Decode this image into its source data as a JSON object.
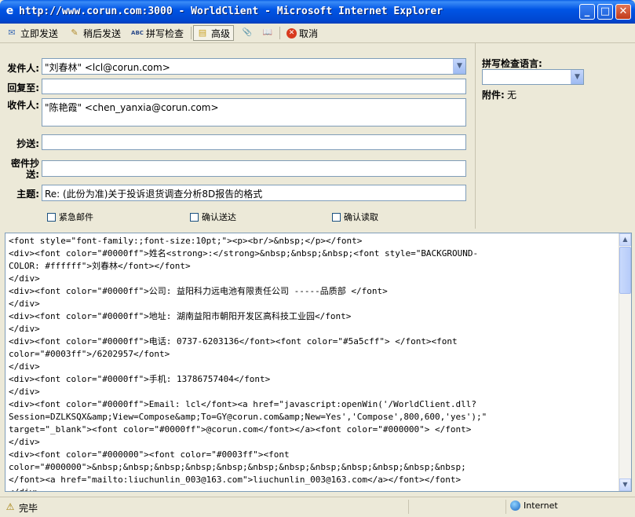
{
  "window": {
    "title": "http://www.corun.com:3000 - WorldClient - Microsoft Internet Explorer",
    "min_glyph": "_",
    "max_glyph": "□",
    "close_glyph": "✕"
  },
  "toolbar": {
    "send_now": "立即发送",
    "send_later": "稍后发送",
    "spell_check": "拼写检查",
    "advanced": "高级",
    "cancel": "取消"
  },
  "icons": {
    "send-now": "✉",
    "send-later": "✎",
    "spell-check": "ABC",
    "advanced": "▤",
    "attach": "📎",
    "address-book": "📖",
    "cancel": "✕",
    "ie": "e",
    "status-page": "⚠",
    "combo": "▼",
    "scroll-up": "▲",
    "scroll-down": "▼"
  },
  "fields": {
    "from_label": "发件人:",
    "from_value": "\"刘春林\" <lcl@corun.com>",
    "reply_to_label": "回复至:",
    "reply_to_value": "",
    "to_label": "收件人:",
    "to_value": "\"陈艳霞\" <chen_yanxia@corun.com>",
    "cc_label": "抄送:",
    "cc_value": "",
    "bcc_label": "密件抄送:",
    "bcc_value": "",
    "subject_label": "主题:",
    "subject_value": "Re: (此份为准)关于投诉退货调查分析8D报告的格式"
  },
  "options": {
    "urgent": "紧急邮件",
    "delivery_receipt": "确认送达",
    "read_receipt": "确认读取"
  },
  "side": {
    "spell_lang_label": "拼写检查语言:",
    "spell_lang_value": "",
    "attachments_label": "附件:",
    "attachments_value": "无"
  },
  "body": {
    "lines": [
      "<font style=\"font-family:;font-size:10pt;\"><p><br/>&nbsp;</p></font>",
      "<div><font color=\"#0000ff\">姓名<strong>:</strong>&nbsp;&nbsp;&nbsp;<font style=\"BACKGROUND-",
      "COLOR: #ffffff\">刘春林</font></font>",
      "</div>",
      "<div><font color=\"#0000ff\">公司: 益阳科力远电池有限责任公司 -----品质部 </font>",
      "</div>",
      "<div><font color=\"#0000ff\">地址: 湖南益阳市朝阳开发区高科技工业园</font>",
      "</div>",
      "<div><font color=\"#0000ff\">电话: 0737-6203136</font><font color=\"#5a5cff\"> </font><font",
      "color=\"#0003ff\">/6202957</font>",
      "</div>",
      "<div><font color=\"#0000ff\">手机: 13786757404</font>",
      "</div>",
      "<div><font color=\"#0000ff\">Email: lcl</font><a href=\"javascript:openWin('/WorldClient.dll?",
      "Session=DZLKSQX&amp;View=Compose&amp;To=GY@corun.com&amp;New=Yes','Compose',800,600,'yes');\"",
      "target=\"_blank\"><font color=\"#0000ff\">@corun.com</font></a><font color=\"#000000\"> </font>",
      "</div>",
      "<div><font color=\"#000000\"><font color=\"#0003ff\"><font",
      "color=\"#000000\">&nbsp;&nbsp;&nbsp;&nbsp;&nbsp;&nbsp;&nbsp;&nbsp;&nbsp;&nbsp;&nbsp;&nbsp;",
      "</font><a href=\"mailto:liuchunlin_003@163.com\">liuchunlin_003@163.com</a></font></font>",
      "</div>"
    ]
  },
  "status": {
    "text": "完毕",
    "zone": "Internet"
  }
}
